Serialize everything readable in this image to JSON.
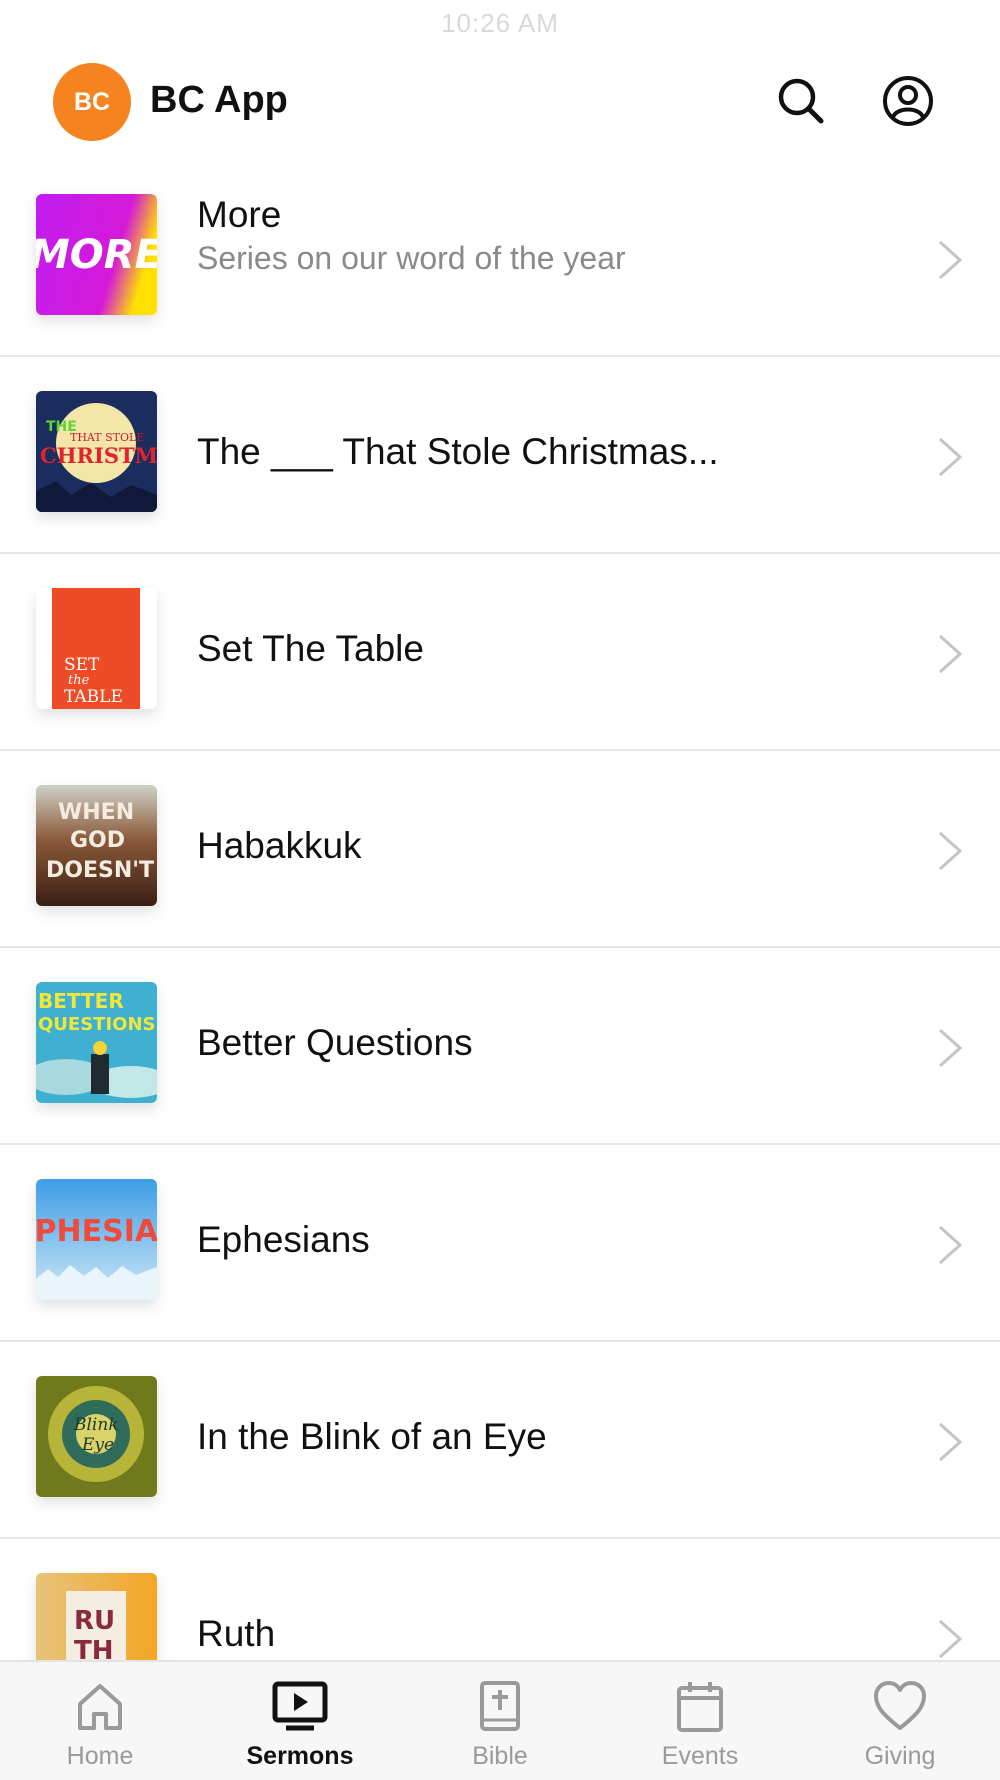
{
  "status_bar": {
    "time": "10:26 AM"
  },
  "header": {
    "avatar_initials": "BC",
    "title": "BC App",
    "accent_color": "#f5831f"
  },
  "sermons": [
    {
      "title": "More",
      "subtitle": "Series on our word of the year",
      "art_text": "MORE"
    },
    {
      "title": "The ___ That Stole Christmas...",
      "subtitle": "",
      "art_text": "THAT STOLE CHRISTMAS"
    },
    {
      "title": "Set The Table",
      "subtitle": "",
      "art_text": "SET the TABLE"
    },
    {
      "title": "Habakkuk",
      "subtitle": "",
      "art_text": "WHEN GOD DOESN'T"
    },
    {
      "title": "Better Questions",
      "subtitle": "",
      "art_text": "BETTER QUESTIONS"
    },
    {
      "title": "Ephesians",
      "subtitle": "",
      "art_text": "EPHESIANS"
    },
    {
      "title": "In the Blink of an Eye",
      "subtitle": "",
      "art_text": "Blink Eye"
    },
    {
      "title": "Ruth",
      "subtitle": "",
      "art_text": "RUTH"
    }
  ],
  "tabbar": {
    "tabs": [
      {
        "label": "Home",
        "icon": "home-icon"
      },
      {
        "label": "Sermons",
        "icon": "tv-play-icon"
      },
      {
        "label": "Bible",
        "icon": "bible-icon"
      },
      {
        "label": "Events",
        "icon": "calendar-icon"
      },
      {
        "label": "Giving",
        "icon": "heart-icon"
      }
    ],
    "active": "Sermons"
  }
}
